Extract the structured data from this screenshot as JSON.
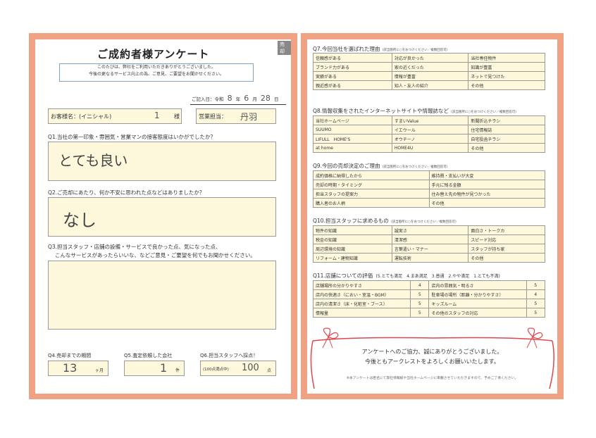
{
  "left": {
    "tag": "売却",
    "title": "ご成約者様アンケート",
    "note_lines": [
      "このたびは、弊社をご利用いただきありがとうございました。",
      "今後の更なるサービス向上の為、ご意見、ご要望をお聞かせください。"
    ],
    "date": {
      "label": "ご記入日：令和",
      "year": "8",
      "year_unit": "年",
      "month": "6",
      "month_unit": "月",
      "day": "28",
      "day_unit": "日"
    },
    "customer": {
      "label": "お客様名：(イニシャル)",
      "value": "1",
      "suffix": "様"
    },
    "staff": {
      "label": "営業担当：",
      "value": "丹羽"
    },
    "q1": {
      "label": "Q1.当社の第一印象・雰囲気・営業マンの接客態度はいかがでしたか？",
      "answer": "とても良い"
    },
    "q2": {
      "label": "Q2.ご売却にあたり、何か不安に思われた点などはありましたか？",
      "answer": "なし"
    },
    "q3": {
      "label_line1": "Q3.担当スタッフ・店舗の設備・サービスで良かった点、気になった点、",
      "label_line2": "こんなサービスがあったらいいな、などご意見・ご要望を何でもお聞かせください。"
    },
    "q4": {
      "label": "Q4.売却までの期間",
      "value": "13",
      "unit": "ヶ月"
    },
    "q5": {
      "label": "Q5.査定依頼した会社",
      "value": "1",
      "unit": "件"
    },
    "q6": {
      "label": "Q6.担当スタッフへ採点！",
      "prefix": "(100点満点中)",
      "value": "100",
      "unit": "点"
    }
  },
  "right": {
    "q7": {
      "label": "Q7.今回当社を選ばれた理由",
      "sub": "(該当箇所に○をおつけください／複数回答可)",
      "rows": [
        [
          "信頼感がある",
          "対応が良かった",
          "当社専任物件"
        ],
        [
          "ブランド力がある",
          "家の近くだった",
          "知識が豊富"
        ],
        [
          "実績がある",
          "情報が豊富",
          "ネットで見つけた"
        ],
        [
          "親近感がある",
          "知人・友人の紹介",
          "その他"
        ]
      ]
    },
    "q8": {
      "label": "Q8.情報収集をされたインターネットサイトや情報誌など",
      "sub": "(該当箇所に○をおつけください／複数回答可)",
      "rows": [
        [
          "当社ホームページ",
          "すまいValue",
          "新聞折込チラシ"
        ],
        [
          "SUUMO",
          "イエウール",
          "住宅情報誌"
        ],
        [
          "LIFULL　HOME'S",
          "オウチーノ",
          "自宅投函チラシ"
        ],
        [
          "at home",
          "HOME4U",
          "その他"
        ]
      ]
    },
    "q9": {
      "label": "Q9.今回の売却決定のご理由",
      "sub": "(該当箇所に○をおつけください／複数回答可)",
      "rows": [
        [
          "成約価格に納得したから",
          "維持費・支払いが大変"
        ],
        [
          "売却の時期・タイミング",
          "手元に残る金額"
        ],
        [
          "担当スタッフの提案力",
          "住み替え先の物件が見つかった"
        ],
        [
          "購入者のお人柄",
          "その他"
        ]
      ]
    },
    "q10": {
      "label": "Q10.担当スタッフに求めるもの",
      "sub": "(該当箇所に○をおつけください／複数回答可)",
      "rows": [
        [
          "物件の知識",
          "誠実さ",
          "面白さ・トークカ"
        ],
        [
          "税金の知識",
          "清潔感",
          "スピード対応"
        ],
        [
          "周辺環境の知識",
          "言葉遣い・マナー",
          "スタッフが持ち家"
        ],
        [
          "リフォーム・建物知識",
          "運転技術",
          "その他"
        ]
      ]
    },
    "q11": {
      "label": "Q11.店舗についての評価",
      "scale": "(5.とても満足　4.まあ満足　3.普通　2.やや満足　1.とても不満)",
      "rows": [
        [
          "店舗場所の分かりやすさ",
          "店内の雰囲気・明るさ"
        ],
        [
          "店内の快適さ（におい・室温・BGM）",
          "駐車場の場所（距離・分かりやすさ）"
        ],
        [
          "店内の清潔さ（床・化粧室・ブース）",
          "キッズルーム"
        ],
        [
          "情報量",
          "その他のスタッフの対応"
        ]
      ],
      "scores": [
        [
          "4",
          "5"
        ],
        [
          "5",
          "4"
        ],
        [
          "5",
          "5"
        ],
        [
          "5",
          "5"
        ]
      ]
    },
    "thanks_line1": "アンケートへのご協力、誠にありがとうございました。",
    "thanks_line2": "今後ともアークレストをよろしくお願いいたします。",
    "footnote": "※本アンケートは匿名にて弊社情報紙や当社ホームページに掲載させていただきますので、予めご了承ください。",
    "colors": {
      "frame": "#f0a282",
      "ribbon": "#e0464b",
      "answer_bg": "#fdf8dc"
    }
  }
}
